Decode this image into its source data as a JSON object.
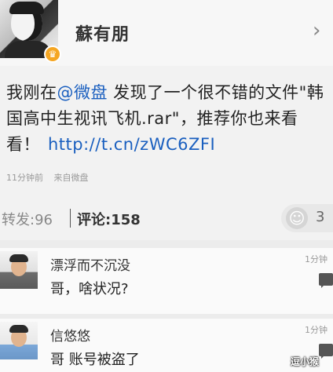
{
  "header": {
    "username": "蘇有朋",
    "chevron": "›",
    "vip_badge": "♛"
  },
  "post": {
    "text_before_mention": "我刚在",
    "mention": "@微盘",
    "text_after_mention": " 发现了一个很不错的文件\"韩国高中生视讯飞机.rar\"，推荐你也来看看！",
    "link": "http://t.cn/zWC6ZFI",
    "time_ago": "11分钟前",
    "source": "来自微盘"
  },
  "actions": {
    "repost_label": "转发:96",
    "comment_label": "评论:158",
    "like_count": "3",
    "like_icon": "☺"
  },
  "comments": [
    {
      "name": "漂浮而不沉没",
      "text": "哥，啥状况?",
      "time": "1分钟"
    },
    {
      "name": "信悠悠",
      "text": "哥 账号被盗了",
      "time": "1分钟"
    }
  ],
  "watermark": "逗小猴",
  "colors": {
    "link": "#1a5fbf",
    "vip": "#f5a623",
    "background": "#ececec"
  },
  "icons": [
    "vip-crown-icon",
    "chevron-right-icon",
    "smile-icon",
    "reply-icon"
  ]
}
